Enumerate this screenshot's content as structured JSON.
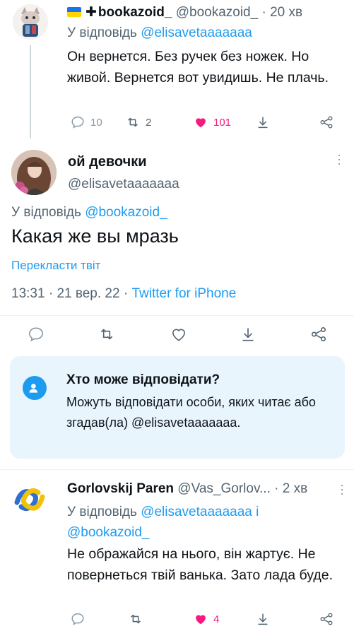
{
  "parent_tweet": {
    "display_name": "bookazoid_",
    "handle": "@bookazoid_",
    "time": "20 хв",
    "reply_prefix": "У відповідь",
    "reply_to": "@elisavetaaaaaaa",
    "text": "Он вернется. Без ручек без ножек. Но живой. Вернется вот увидишь. Не плачь.",
    "replies": "10",
    "retweets": "2",
    "likes": "101",
    "like_color": "#f91880"
  },
  "main_tweet": {
    "display_name": "ой девочки",
    "handle": "@elisavetaaaaaaa",
    "reply_prefix": "У відповідь",
    "reply_to": "@bookazoid_",
    "text": "Какая же вы мразь",
    "translate_label": "Перекласти твіт",
    "time": "13:31",
    "date": "21 вер. 22",
    "source": "Twitter for iPhone"
  },
  "who_can_reply": {
    "title": "Хто може відповідати?",
    "description": "Можуть відповідати особи, яких читає або згадав(ла) @elisavetaaaaaaa.",
    "icon": "at-mention-icon"
  },
  "reply_tweet": {
    "display_name": "Gorlovskij Paren",
    "handle": "@Vas_Gorlov...",
    "time": "2 хв",
    "reply_prefix": "У відповідь",
    "reply_to_1": "@elisavetaaaaaaa",
    "reply_joiner": "і",
    "reply_to_2": "@bookazoid_",
    "text": "Не ображайся на нього, він жартує. Не повернеться твій ванька. Зато лада буде.",
    "likes": "4",
    "like_color": "#f91880"
  },
  "colors": {
    "accent": "#1d9bf0",
    "secondary_text": "#536471",
    "card_background": "#e8f5fd"
  }
}
